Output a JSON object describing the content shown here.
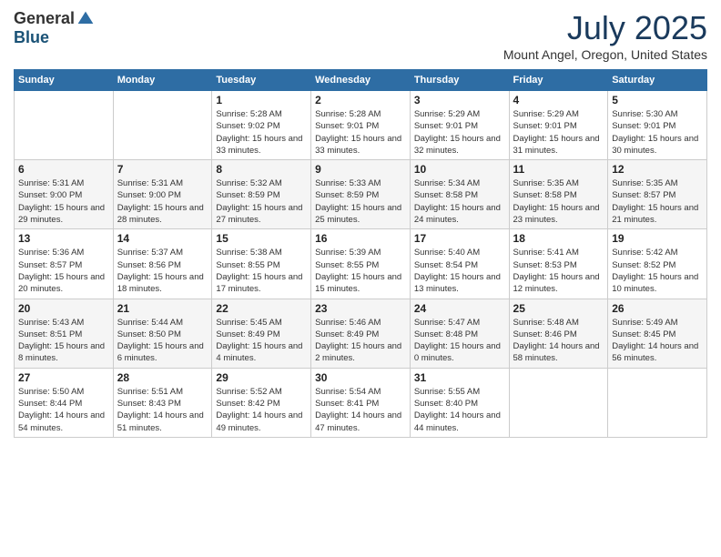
{
  "logo": {
    "general": "General",
    "blue": "Blue"
  },
  "title": "July 2025",
  "location": "Mount Angel, Oregon, United States",
  "days_header": [
    "Sunday",
    "Monday",
    "Tuesday",
    "Wednesday",
    "Thursday",
    "Friday",
    "Saturday"
  ],
  "weeks": [
    [
      {
        "day": "",
        "sunrise": "",
        "sunset": "",
        "daylight": ""
      },
      {
        "day": "",
        "sunrise": "",
        "sunset": "",
        "daylight": ""
      },
      {
        "day": "1",
        "sunrise": "Sunrise: 5:28 AM",
        "sunset": "Sunset: 9:02 PM",
        "daylight": "Daylight: 15 hours and 33 minutes."
      },
      {
        "day": "2",
        "sunrise": "Sunrise: 5:28 AM",
        "sunset": "Sunset: 9:01 PM",
        "daylight": "Daylight: 15 hours and 33 minutes."
      },
      {
        "day": "3",
        "sunrise": "Sunrise: 5:29 AM",
        "sunset": "Sunset: 9:01 PM",
        "daylight": "Daylight: 15 hours and 32 minutes."
      },
      {
        "day": "4",
        "sunrise": "Sunrise: 5:29 AM",
        "sunset": "Sunset: 9:01 PM",
        "daylight": "Daylight: 15 hours and 31 minutes."
      },
      {
        "day": "5",
        "sunrise": "Sunrise: 5:30 AM",
        "sunset": "Sunset: 9:01 PM",
        "daylight": "Daylight: 15 hours and 30 minutes."
      }
    ],
    [
      {
        "day": "6",
        "sunrise": "Sunrise: 5:31 AM",
        "sunset": "Sunset: 9:00 PM",
        "daylight": "Daylight: 15 hours and 29 minutes."
      },
      {
        "day": "7",
        "sunrise": "Sunrise: 5:31 AM",
        "sunset": "Sunset: 9:00 PM",
        "daylight": "Daylight: 15 hours and 28 minutes."
      },
      {
        "day": "8",
        "sunrise": "Sunrise: 5:32 AM",
        "sunset": "Sunset: 8:59 PM",
        "daylight": "Daylight: 15 hours and 27 minutes."
      },
      {
        "day": "9",
        "sunrise": "Sunrise: 5:33 AM",
        "sunset": "Sunset: 8:59 PM",
        "daylight": "Daylight: 15 hours and 25 minutes."
      },
      {
        "day": "10",
        "sunrise": "Sunrise: 5:34 AM",
        "sunset": "Sunset: 8:58 PM",
        "daylight": "Daylight: 15 hours and 24 minutes."
      },
      {
        "day": "11",
        "sunrise": "Sunrise: 5:35 AM",
        "sunset": "Sunset: 8:58 PM",
        "daylight": "Daylight: 15 hours and 23 minutes."
      },
      {
        "day": "12",
        "sunrise": "Sunrise: 5:35 AM",
        "sunset": "Sunset: 8:57 PM",
        "daylight": "Daylight: 15 hours and 21 minutes."
      }
    ],
    [
      {
        "day": "13",
        "sunrise": "Sunrise: 5:36 AM",
        "sunset": "Sunset: 8:57 PM",
        "daylight": "Daylight: 15 hours and 20 minutes."
      },
      {
        "day": "14",
        "sunrise": "Sunrise: 5:37 AM",
        "sunset": "Sunset: 8:56 PM",
        "daylight": "Daylight: 15 hours and 18 minutes."
      },
      {
        "day": "15",
        "sunrise": "Sunrise: 5:38 AM",
        "sunset": "Sunset: 8:55 PM",
        "daylight": "Daylight: 15 hours and 17 minutes."
      },
      {
        "day": "16",
        "sunrise": "Sunrise: 5:39 AM",
        "sunset": "Sunset: 8:55 PM",
        "daylight": "Daylight: 15 hours and 15 minutes."
      },
      {
        "day": "17",
        "sunrise": "Sunrise: 5:40 AM",
        "sunset": "Sunset: 8:54 PM",
        "daylight": "Daylight: 15 hours and 13 minutes."
      },
      {
        "day": "18",
        "sunrise": "Sunrise: 5:41 AM",
        "sunset": "Sunset: 8:53 PM",
        "daylight": "Daylight: 15 hours and 12 minutes."
      },
      {
        "day": "19",
        "sunrise": "Sunrise: 5:42 AM",
        "sunset": "Sunset: 8:52 PM",
        "daylight": "Daylight: 15 hours and 10 minutes."
      }
    ],
    [
      {
        "day": "20",
        "sunrise": "Sunrise: 5:43 AM",
        "sunset": "Sunset: 8:51 PM",
        "daylight": "Daylight: 15 hours and 8 minutes."
      },
      {
        "day": "21",
        "sunrise": "Sunrise: 5:44 AM",
        "sunset": "Sunset: 8:50 PM",
        "daylight": "Daylight: 15 hours and 6 minutes."
      },
      {
        "day": "22",
        "sunrise": "Sunrise: 5:45 AM",
        "sunset": "Sunset: 8:49 PM",
        "daylight": "Daylight: 15 hours and 4 minutes."
      },
      {
        "day": "23",
        "sunrise": "Sunrise: 5:46 AM",
        "sunset": "Sunset: 8:49 PM",
        "daylight": "Daylight: 15 hours and 2 minutes."
      },
      {
        "day": "24",
        "sunrise": "Sunrise: 5:47 AM",
        "sunset": "Sunset: 8:48 PM",
        "daylight": "Daylight: 15 hours and 0 minutes."
      },
      {
        "day": "25",
        "sunrise": "Sunrise: 5:48 AM",
        "sunset": "Sunset: 8:46 PM",
        "daylight": "Daylight: 14 hours and 58 minutes."
      },
      {
        "day": "26",
        "sunrise": "Sunrise: 5:49 AM",
        "sunset": "Sunset: 8:45 PM",
        "daylight": "Daylight: 14 hours and 56 minutes."
      }
    ],
    [
      {
        "day": "27",
        "sunrise": "Sunrise: 5:50 AM",
        "sunset": "Sunset: 8:44 PM",
        "daylight": "Daylight: 14 hours and 54 minutes."
      },
      {
        "day": "28",
        "sunrise": "Sunrise: 5:51 AM",
        "sunset": "Sunset: 8:43 PM",
        "daylight": "Daylight: 14 hours and 51 minutes."
      },
      {
        "day": "29",
        "sunrise": "Sunrise: 5:52 AM",
        "sunset": "Sunset: 8:42 PM",
        "daylight": "Daylight: 14 hours and 49 minutes."
      },
      {
        "day": "30",
        "sunrise": "Sunrise: 5:54 AM",
        "sunset": "Sunset: 8:41 PM",
        "daylight": "Daylight: 14 hours and 47 minutes."
      },
      {
        "day": "31",
        "sunrise": "Sunrise: 5:55 AM",
        "sunset": "Sunset: 8:40 PM",
        "daylight": "Daylight: 14 hours and 44 minutes."
      },
      {
        "day": "",
        "sunrise": "",
        "sunset": "",
        "daylight": ""
      },
      {
        "day": "",
        "sunrise": "",
        "sunset": "",
        "daylight": ""
      }
    ]
  ]
}
